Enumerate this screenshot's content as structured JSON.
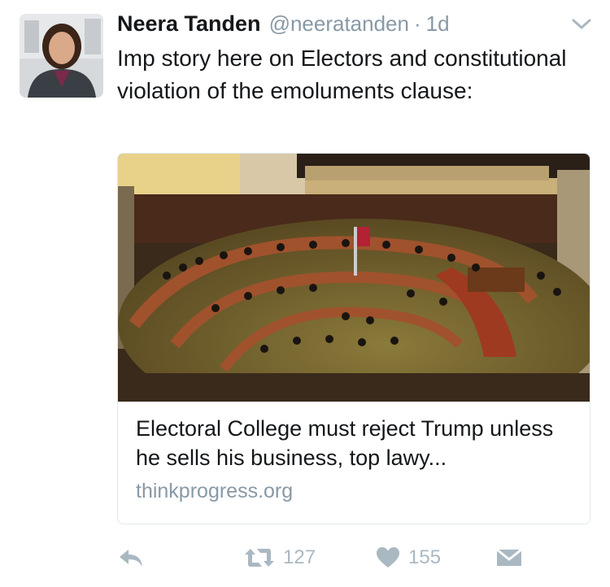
{
  "tweet": {
    "author_name": "Neera Tanden",
    "handle": "@neeratanden",
    "separator": "·",
    "time": "1d",
    "text": "Imp story here on Electors and constitutional violation of the emoluments clause:",
    "avatar_icon": "profile-photo",
    "menu_icon": "chevron-down-icon"
  },
  "card": {
    "image_icon": "senate-chamber-photo",
    "title": "Electoral College must reject Trump unless he sells his business, top lawy...",
    "domain": "thinkprogress.org"
  },
  "actions": {
    "reply_icon": "reply-icon",
    "retweet_icon": "retweet-icon",
    "retweet_count": "127",
    "like_icon": "heart-icon",
    "like_count": "155",
    "dm_icon": "envelope-icon"
  },
  "colors": {
    "text": "#14171a",
    "secondary": "#8899a6",
    "icon": "#aab8c2",
    "border": "#e1e8ed"
  }
}
